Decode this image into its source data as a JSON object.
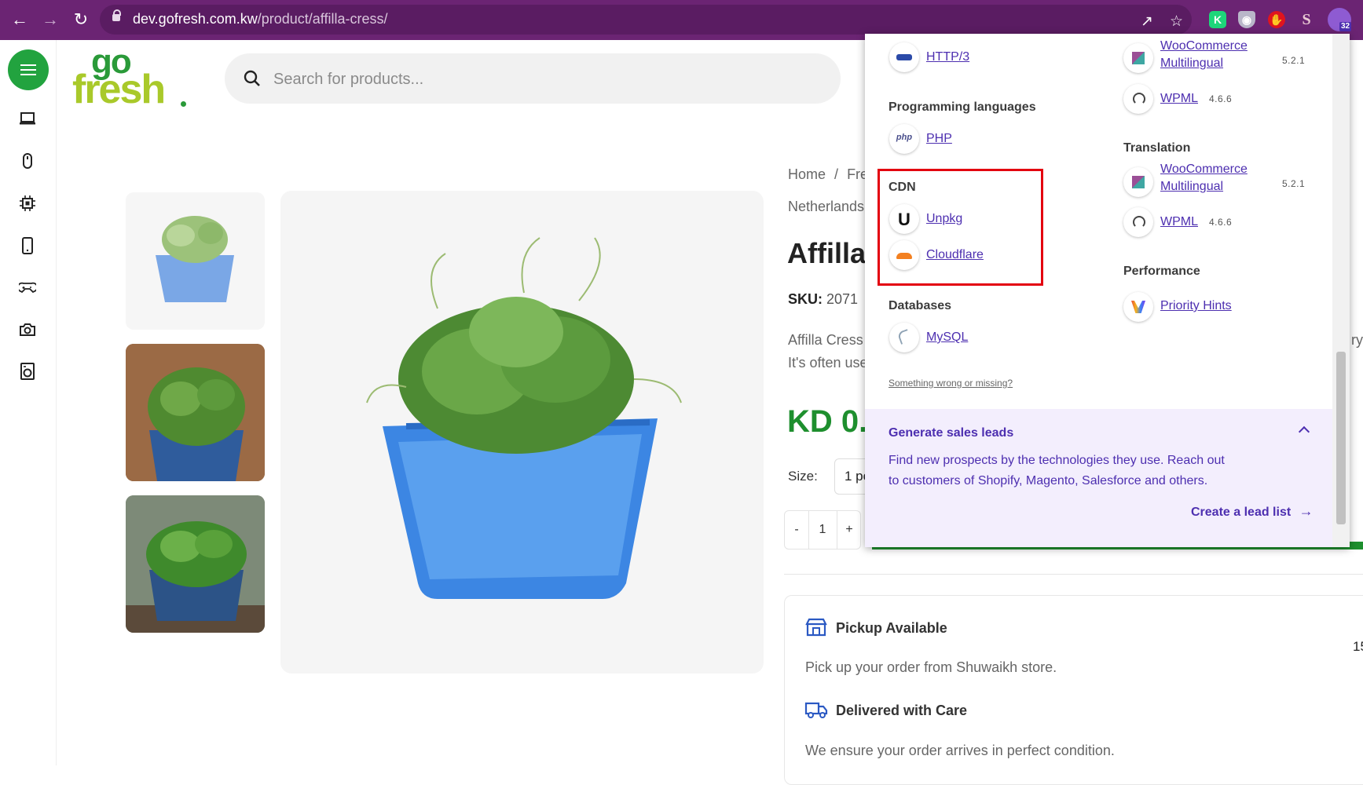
{
  "browser": {
    "url_host": "dev.gofresh.com.kw",
    "url_path": "/product/affilla-cress/",
    "ext_badge": "32",
    "icons": [
      "back-icon",
      "forward-icon",
      "reload-icon",
      "lock-icon",
      "share-icon",
      "star-icon",
      "extension-k-icon",
      "extension-shield-icon",
      "extension-hand-icon",
      "extension-s-icon",
      "wappalyzer-icon"
    ]
  },
  "header": {
    "logo_top": "go",
    "logo_bottom": "fresh",
    "search_placeholder": "Search for products..."
  },
  "rail": {
    "items": [
      "laptop-icon",
      "mouse-icon",
      "chip-icon",
      "phone-icon",
      "gamepad-icon",
      "camera-icon",
      "washer-icon"
    ]
  },
  "product": {
    "breadcrumb_home": "Home",
    "breadcrumb_sep": "/",
    "breadcrumb_next": "Fre",
    "breadcrumb_line2": "Netherlands",
    "title": "Affilla",
    "sku_label": "SKU:",
    "sku_value": "2071",
    "desc_line1": "Affilla Cress",
    "desc_line2": "It's often use",
    "desc_tail": "ry",
    "price": "KD 0.",
    "size_label": "Size:",
    "size_value": "1 pc",
    "qty_minus": "-",
    "qty_value": "1",
    "qty_plus": "+",
    "pickup_title": "Pickup Available",
    "pickup_text": "Pick up your order from Shuwaikh store.",
    "pickup_side": "15",
    "delivery_title": "Delivered with Care",
    "delivery_text": "We ensure your order arrives in perfect condition."
  },
  "wappalyzer": {
    "left": {
      "http3": "HTTP/3",
      "prog_heading": "Programming languages",
      "php": "PHP",
      "cdn_heading": "CDN",
      "unpkg": "Unpkg",
      "cloudflare": "Cloudflare",
      "db_heading": "Databases",
      "mysql": "MySQL",
      "wrong_link": "Something wrong or missing?"
    },
    "right": {
      "woo_1_line1": "WooCommerce",
      "woo_1_line2": "Multilingual",
      "woo_1_ver": "5.2.1",
      "wpml_1": "WPML",
      "wpml_1_ver": "4.6.6",
      "translation_heading": "Translation",
      "woo_2_line1": "WooCommerce",
      "woo_2_line2": "Multilingual",
      "woo_2_ver": "5.2.1",
      "wpml_2": "WPML",
      "wpml_2_ver": "4.6.6",
      "performance_heading": "Performance",
      "priority_hints": "Priority Hints"
    },
    "leads": {
      "heading": "Generate sales leads",
      "text_line1": "Find new prospects by the technologies they use. Reach out",
      "text_line2": "to customers of Shopify, Magento, Salesforce and others.",
      "cta": "Create a lead list"
    }
  },
  "colors": {
    "chrome": "#6b2473",
    "brand_green": "#22a33f",
    "logo_green": "#a9c92a",
    "link_purple": "#4d2fb0",
    "highlight_red": "#e3000f",
    "price_green": "#1e8f2e"
  }
}
